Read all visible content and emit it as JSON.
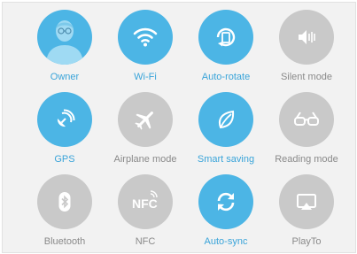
{
  "colors": {
    "active": "#4cb5e5",
    "active_label": "#3aa4d9",
    "inactive": "#c9c9c9",
    "inactive_label": "#8a8a8a",
    "background": "#f2f2f2"
  },
  "tiles": [
    {
      "label": "Owner",
      "icon": "avatar-icon",
      "active": true
    },
    {
      "label": "Wi-Fi",
      "icon": "wifi-icon",
      "active": true
    },
    {
      "label": "Auto-rotate",
      "icon": "rotate-icon",
      "active": true
    },
    {
      "label": "Silent mode",
      "icon": "silent-mode-icon",
      "active": false
    },
    {
      "label": "GPS",
      "icon": "gps-icon",
      "active": true
    },
    {
      "label": "Airplane mode",
      "icon": "airplane-icon",
      "active": false
    },
    {
      "label": "Smart saving",
      "icon": "leaf-icon",
      "active": true
    },
    {
      "label": "Reading mode",
      "icon": "glasses-icon",
      "active": false
    },
    {
      "label": "Bluetooth",
      "icon": "bluetooth-icon",
      "active": false
    },
    {
      "label": "NFC",
      "icon": "nfc-icon",
      "active": false
    },
    {
      "label": "Auto-sync",
      "icon": "sync-icon",
      "active": true
    },
    {
      "label": "PlayTo",
      "icon": "cast-icon",
      "active": false
    }
  ]
}
